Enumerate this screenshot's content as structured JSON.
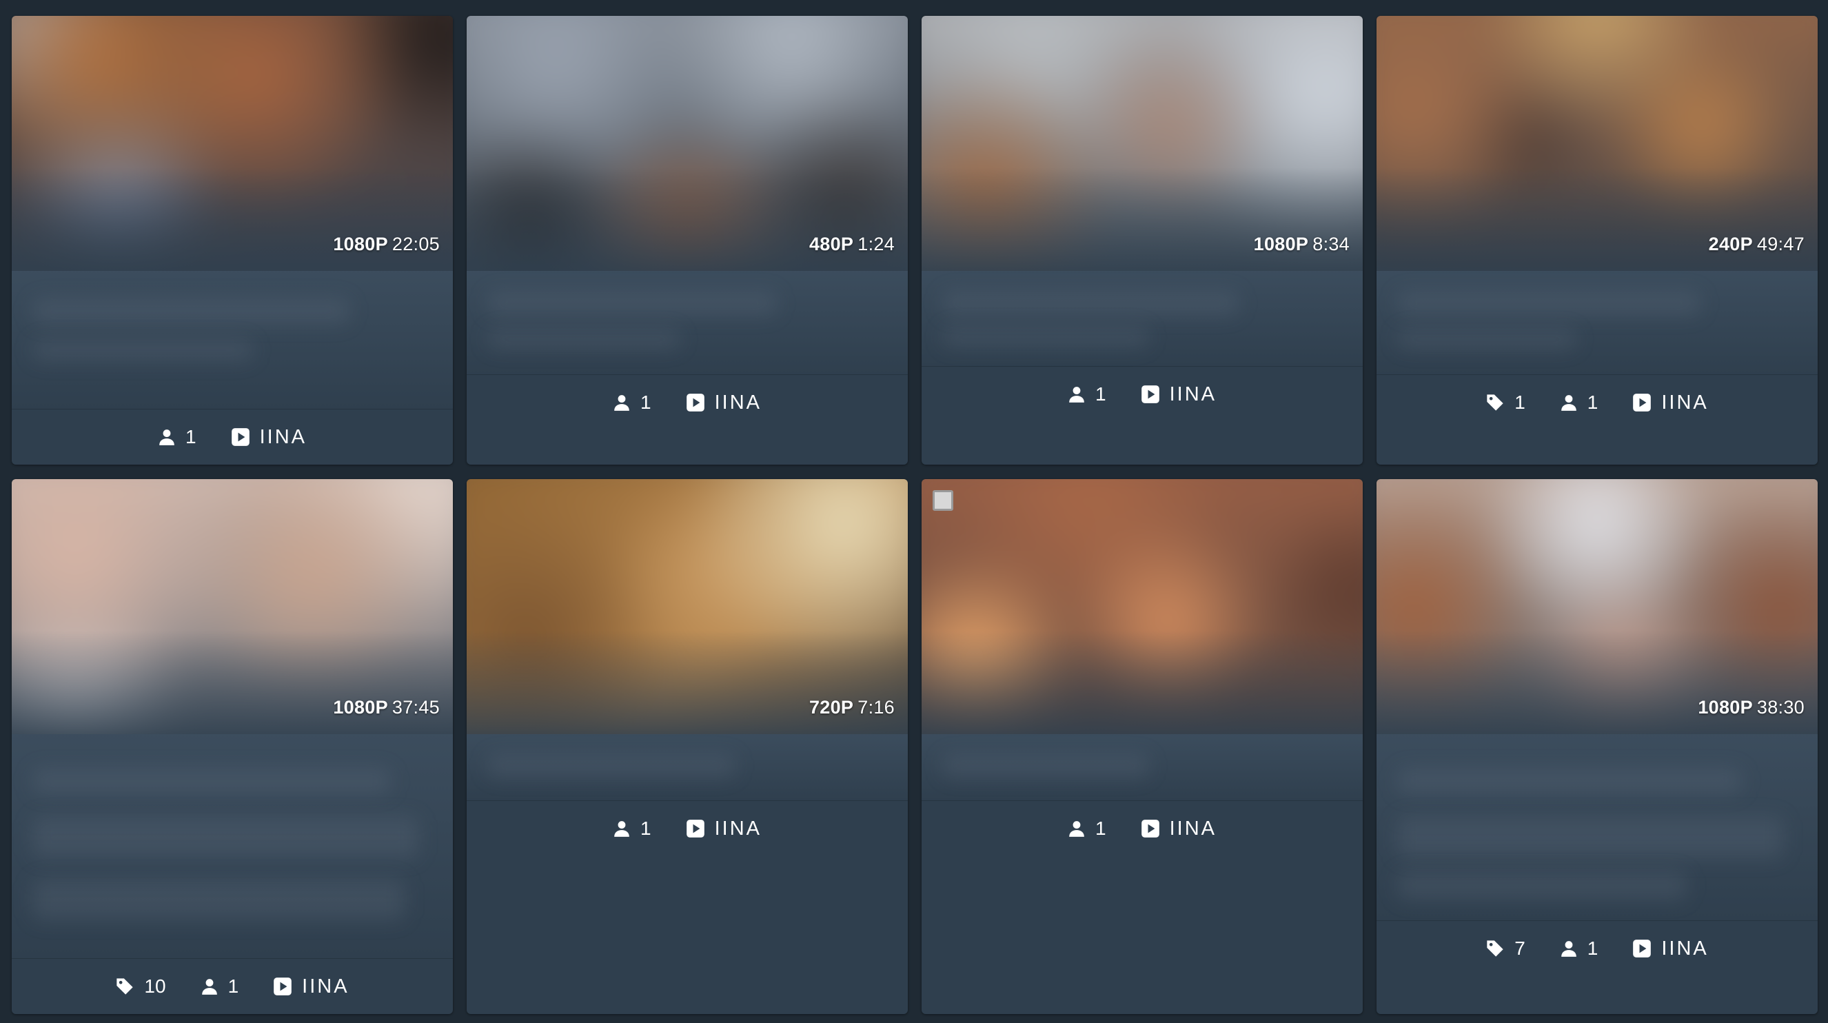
{
  "scenes": [
    {
      "resolution": "1080P",
      "duration": "22:05",
      "performers": "1",
      "tags": null,
      "studio": "IINA"
    },
    {
      "resolution": "480P",
      "duration": "1:24",
      "performers": "1",
      "tags": null,
      "studio": "IINA"
    },
    {
      "resolution": "1080P",
      "duration": "8:34",
      "performers": "1",
      "tags": null,
      "studio": "IINA"
    },
    {
      "resolution": "240P",
      "duration": "49:47",
      "performers": "1",
      "tags": "1",
      "studio": "IINA"
    },
    {
      "resolution": "1080P",
      "duration": "37:45",
      "performers": "1",
      "tags": "10",
      "studio": "IINA"
    },
    {
      "resolution": "720P",
      "duration": "7:16",
      "performers": "1",
      "tags": null,
      "studio": "IINA"
    },
    {
      "resolution": "",
      "duration": "",
      "performers": "1",
      "tags": null,
      "studio": "IINA",
      "select_checkbox": true
    },
    {
      "resolution": "1080P",
      "duration": "38:30",
      "performers": "1",
      "tags": "7",
      "studio": "IINA"
    }
  ],
  "icons": {
    "tag": "tag-icon",
    "performer": "user-icon",
    "studio": "play-box-icon"
  }
}
